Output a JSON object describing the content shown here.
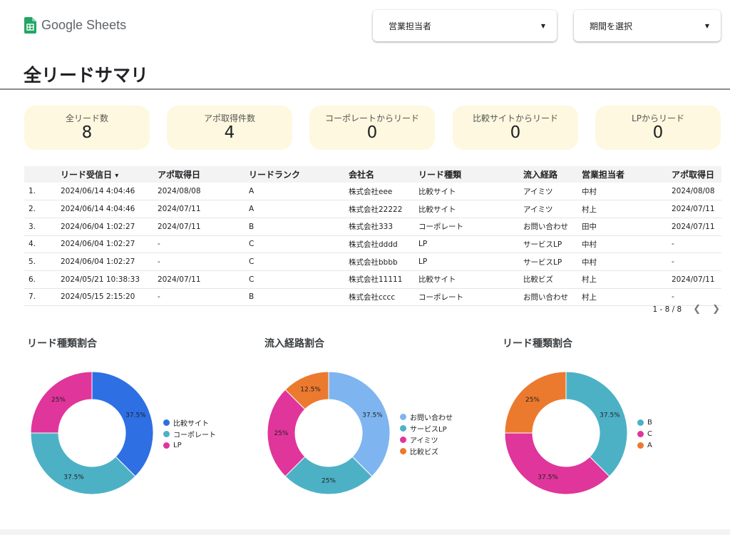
{
  "app": {
    "brand": "Google Sheets",
    "logo_icon": "google-sheets-icon"
  },
  "filters": [
    {
      "label": "営業担当者",
      "icon": "caret-down-icon"
    },
    {
      "label": "期間を選択",
      "icon": "caret-down-icon"
    }
  ],
  "page_title": "全リードサマリ",
  "kpis": [
    {
      "label": "全リード数",
      "value": "8"
    },
    {
      "label": "アポ取得件数",
      "value": "4"
    },
    {
      "label": "コーポレートからリード",
      "value": "0"
    },
    {
      "label": "比較サイトからリード",
      "value": "0"
    },
    {
      "label": "LPからリード",
      "value": "0"
    }
  ],
  "colors": {
    "kpi_bg": "#fdf8df",
    "blue": "#2e6fe4",
    "teal": "#4db1c6",
    "pink": "#e0359b",
    "light_blue": "#7eb5f0",
    "orange": "#eb7a2f"
  },
  "table": {
    "sort_icon": "sort-desc-icon",
    "headers": [
      "",
      "リード受信日",
      "アポ取得日",
      "リードランク",
      "会社名",
      "リード種類",
      "流入経路",
      "営業担当者",
      "アポ取得日"
    ],
    "sort_indicator": "▾",
    "rows": [
      [
        "1.",
        "2024/06/14 4:04:46",
        "2024/08/08",
        "A",
        "株式会社eee",
        "比較サイト",
        "アイミツ",
        "中村",
        "2024/08/08"
      ],
      [
        "2.",
        "2024/06/14 4:04:46",
        "2024/07/11",
        "A",
        "株式会社22222",
        "比較サイト",
        "アイミツ",
        "村上",
        "2024/07/11"
      ],
      [
        "3.",
        "2024/06/04 1:02:27",
        "2024/07/11",
        "B",
        "株式会社333",
        "コーポレート",
        "お問い合わせ",
        "田中",
        "2024/07/11"
      ],
      [
        "4.",
        "2024/06/04 1:02:27",
        "-",
        "C",
        "株式会社dddd",
        "LP",
        "サービスLP",
        "中村",
        "-"
      ],
      [
        "5.",
        "2024/06/04 1:02:27",
        "-",
        "C",
        "株式会社bbbb",
        "LP",
        "サービスLP",
        "中村",
        "-"
      ],
      [
        "6.",
        "2024/05/21 10:38:33",
        "2024/07/11",
        "C",
        "株式会社11111",
        "比較サイト",
        "比較ビズ",
        "村上",
        "2024/07/11"
      ],
      [
        "7.",
        "2024/05/15 2:15:20",
        "-",
        "B",
        "株式会社cccc",
        "コーポレート",
        "お問い合わせ",
        "村上",
        "-"
      ]
    ],
    "pager_text": "1 - 8 / 8",
    "prev_icon": "chevron-left-icon",
    "next_icon": "chevron-right-icon"
  },
  "chart_data": [
    {
      "type": "pie",
      "title": "リード種類割合",
      "categories": [
        "比較サイト",
        "コーポレート",
        "LP"
      ],
      "values": [
        37.5,
        37.5,
        25
      ],
      "labels": [
        "37.5%",
        "37.5%",
        "25%"
      ],
      "colors": [
        "#2e6fe4",
        "#4db1c6",
        "#e0359b"
      ],
      "legend": "right"
    },
    {
      "type": "pie",
      "title": "流入経路割合",
      "categories": [
        "お問い合わせ",
        "サービスLP",
        "アイミツ",
        "比較ビズ"
      ],
      "values": [
        37.5,
        25,
        25,
        12.5
      ],
      "labels": [
        "37.5%",
        "25%",
        "25%",
        "12.5%"
      ],
      "colors": [
        "#7eb5f0",
        "#4db1c6",
        "#e0359b",
        "#eb7a2f"
      ],
      "legend": "right"
    },
    {
      "type": "pie",
      "title": "リード種類割合",
      "categories": [
        "B",
        "C",
        "A"
      ],
      "values": [
        37.5,
        37.5,
        25
      ],
      "labels": [
        "37.5%",
        "37.5%",
        "25%"
      ],
      "colors": [
        "#4db1c6",
        "#e0359b",
        "#eb7a2f"
      ],
      "legend": "right"
    }
  ]
}
